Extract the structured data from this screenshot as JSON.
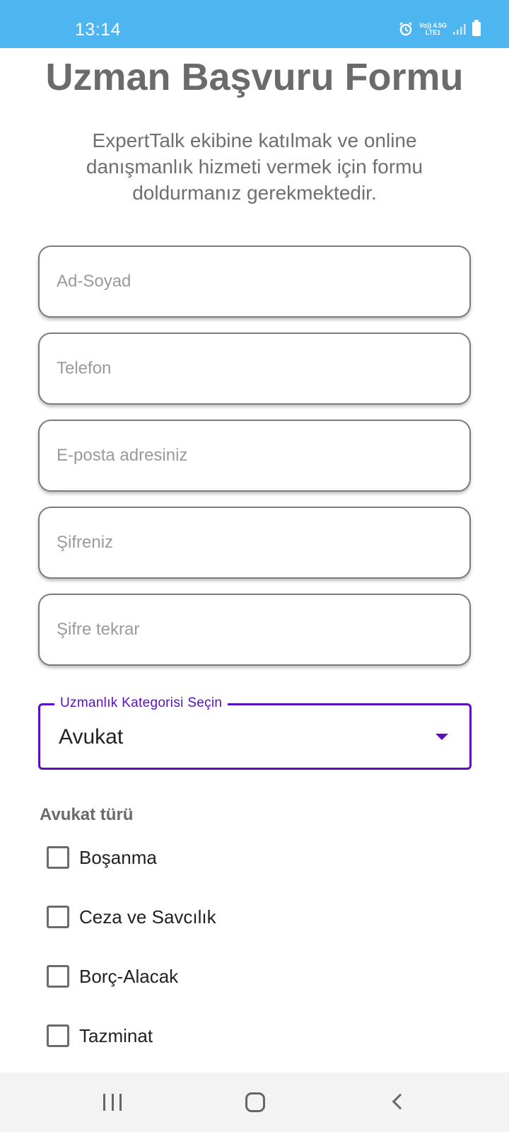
{
  "status_bar": {
    "time": "13:14",
    "network_top": "Vo)) 4.5G",
    "network_bottom": "LTE1",
    "icons": [
      "alarm-icon",
      "signal-icon",
      "battery-icon"
    ]
  },
  "header": {
    "title": "Uzman Başvuru Formu",
    "subtitle": "ExpertTalk ekibine katılmak ve online danışmanlık hizmeti vermek için formu doldurmanız gerekmektedir."
  },
  "form": {
    "fields": [
      {
        "placeholder": "Ad-Soyad",
        "value": ""
      },
      {
        "placeholder": "Telefon",
        "value": ""
      },
      {
        "placeholder": "E-posta adresiniz",
        "value": ""
      },
      {
        "placeholder": "Şifreniz",
        "value": ""
      },
      {
        "placeholder": "Şifre tekrar",
        "value": ""
      }
    ],
    "category": {
      "label": "Uzmanlık Kategorisi Seçin",
      "selected": "Avukat"
    },
    "lawyer_types": {
      "title": "Avukat türü",
      "options": [
        {
          "label": "Boşanma",
          "checked": false
        },
        {
          "label": "Ceza ve Savcılık",
          "checked": false
        },
        {
          "label": "Borç-Alacak",
          "checked": false
        },
        {
          "label": "Tazminat",
          "checked": false
        }
      ]
    }
  },
  "colors": {
    "status_bar": "#4db6f0",
    "accent": "#5b0fbf",
    "title": "#6b6b6b"
  }
}
